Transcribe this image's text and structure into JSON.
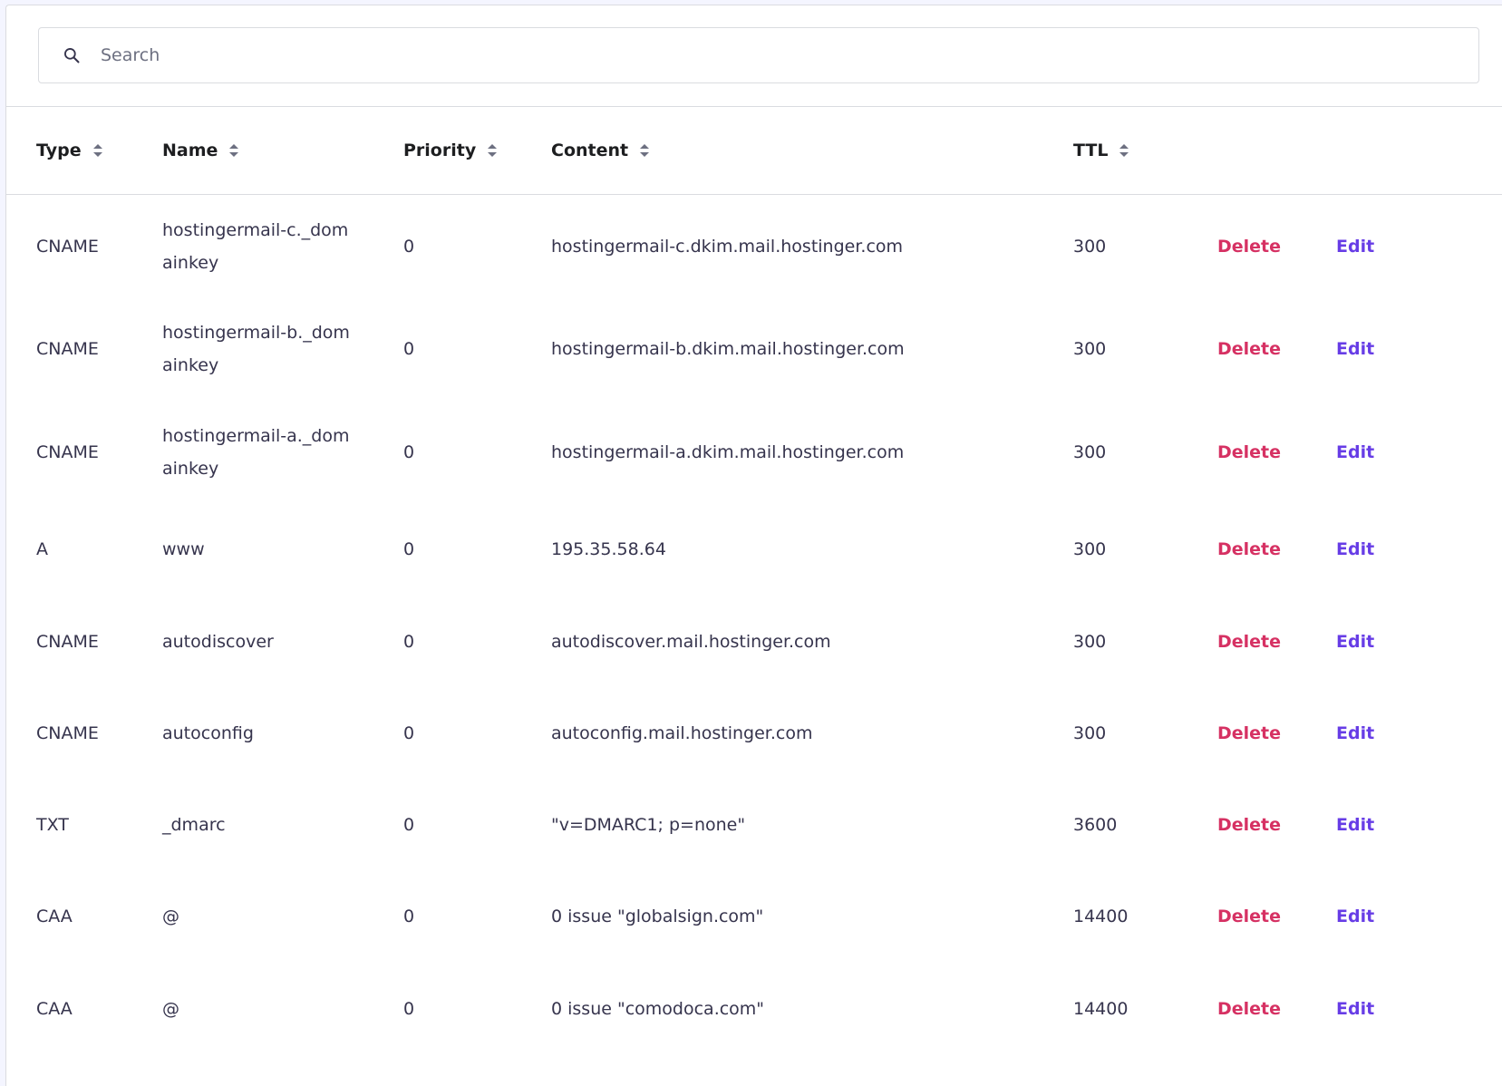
{
  "search": {
    "placeholder": "Search",
    "value": ""
  },
  "columns": [
    {
      "label": "Type"
    },
    {
      "label": "Name"
    },
    {
      "label": "Priority"
    },
    {
      "label": "Content"
    },
    {
      "label": "TTL"
    }
  ],
  "rows": [
    {
      "type": "CNAME",
      "name": "hostingermail-c._domainkey",
      "priority": "0",
      "content": "hostingermail-c.dkim.mail.hostinger.com",
      "ttl": "300",
      "delete": "Delete",
      "edit": "Edit"
    },
    {
      "type": "CNAME",
      "name": "hostingermail-b._domainkey",
      "priority": "0",
      "content": "hostingermail-b.dkim.mail.hostinger.com",
      "ttl": "300",
      "delete": "Delete",
      "edit": "Edit"
    },
    {
      "type": "CNAME",
      "name": "hostingermail-a._domainkey",
      "priority": "0",
      "content": "hostingermail-a.dkim.mail.hostinger.com",
      "ttl": "300",
      "delete": "Delete",
      "edit": "Edit"
    },
    {
      "type": "A",
      "name": "www",
      "priority": "0",
      "content": "195.35.58.64",
      "ttl": "300",
      "delete": "Delete",
      "edit": "Edit"
    },
    {
      "type": "CNAME",
      "name": "autodiscover",
      "priority": "0",
      "content": "autodiscover.mail.hostinger.com",
      "ttl": "300",
      "delete": "Delete",
      "edit": "Edit"
    },
    {
      "type": "CNAME",
      "name": "autoconfig",
      "priority": "0",
      "content": "autoconfig.mail.hostinger.com",
      "ttl": "300",
      "delete": "Delete",
      "edit": "Edit"
    },
    {
      "type": "TXT",
      "name": "_dmarc",
      "priority": "0",
      "content": "\"v=DMARC1; p=none\"",
      "ttl": "3600",
      "delete": "Delete",
      "edit": "Edit"
    },
    {
      "type": "CAA",
      "name": "@",
      "priority": "0",
      "content": "0 issue \"globalsign.com\"",
      "ttl": "14400",
      "delete": "Delete",
      "edit": "Edit"
    },
    {
      "type": "CAA",
      "name": "@",
      "priority": "0",
      "content": "0 issue \"comodoca.com\"",
      "ttl": "14400",
      "delete": "Delete",
      "edit": "Edit"
    }
  ],
  "colors": {
    "delete": "#d63163",
    "edit": "#673de6",
    "border": "#dadce0"
  }
}
